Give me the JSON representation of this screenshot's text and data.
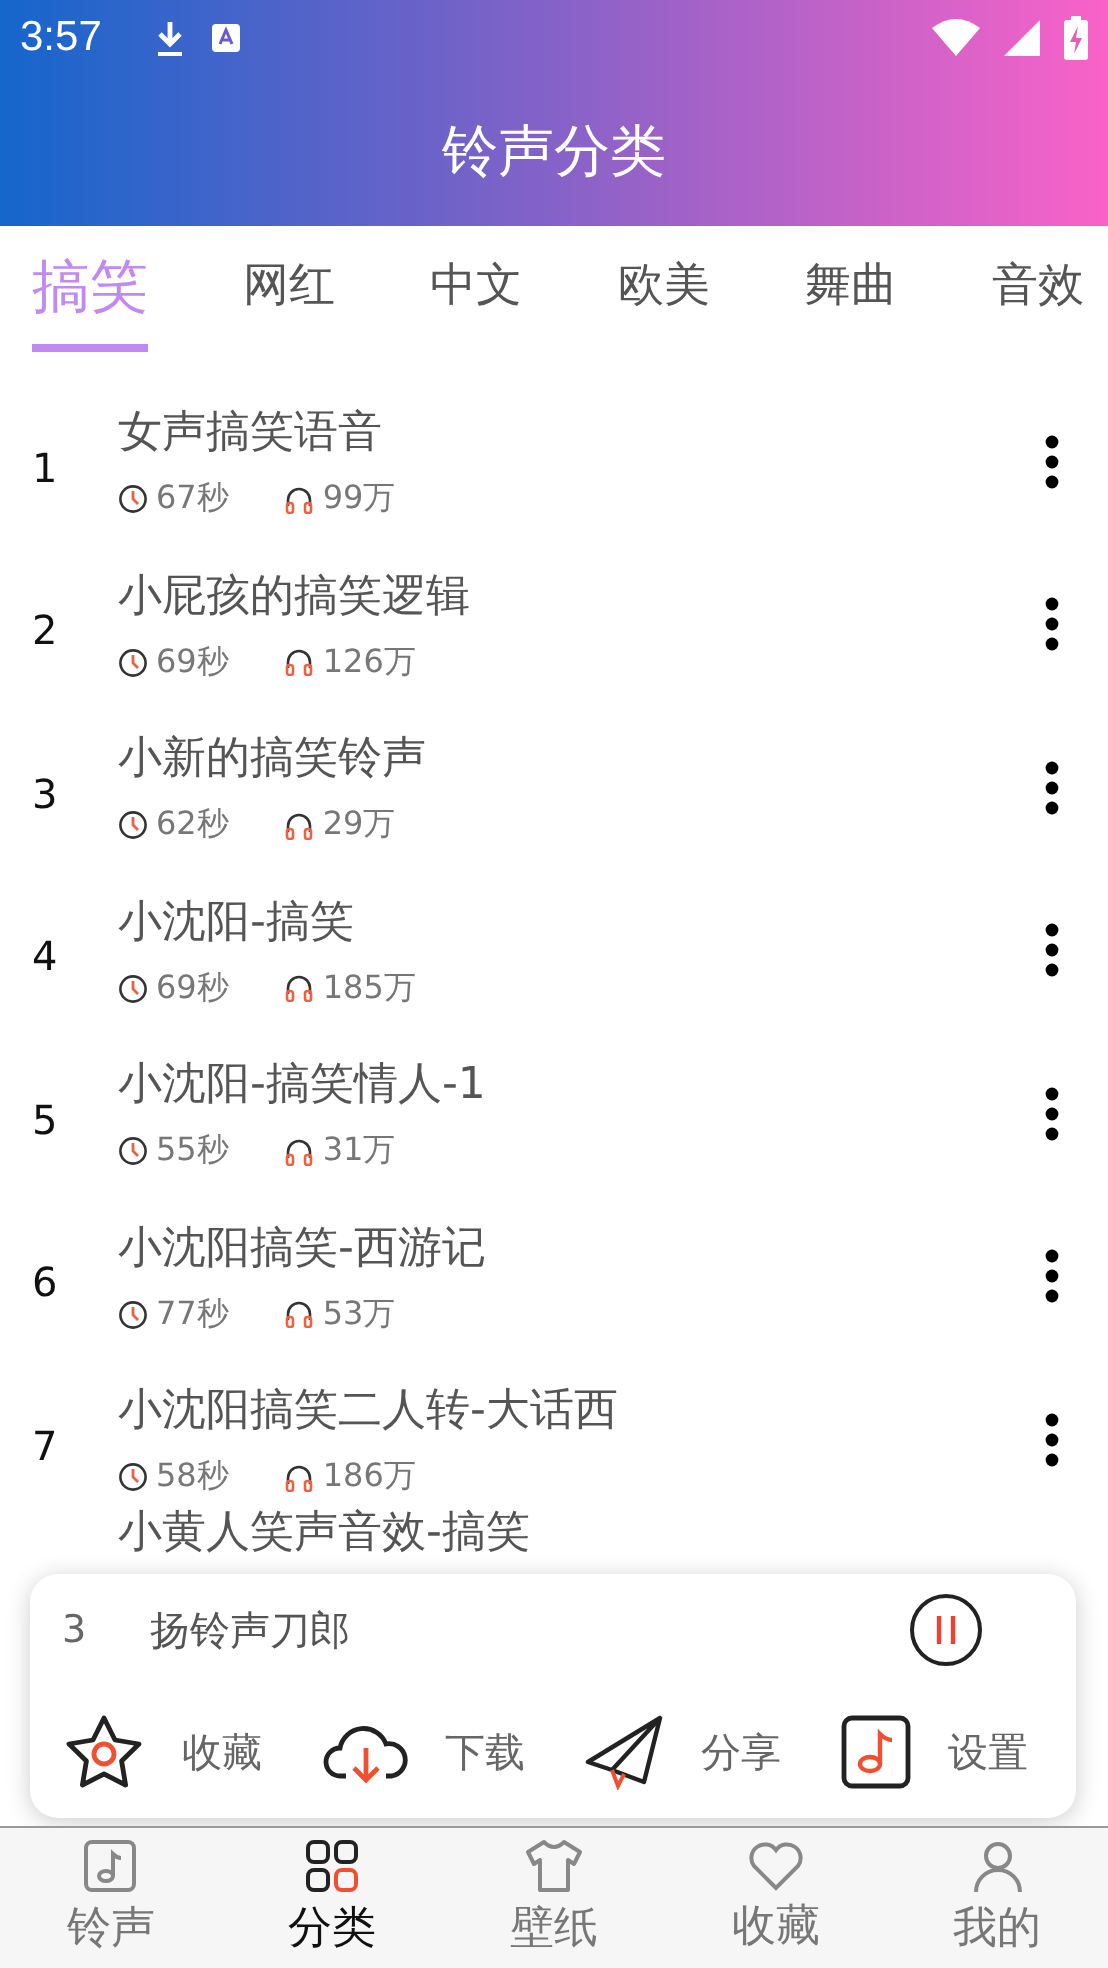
{
  "status_bar": {
    "time": "3:57"
  },
  "header": {
    "title": "铃声分类"
  },
  "tabs": [
    {
      "label": "搞笑",
      "selected": true
    },
    {
      "label": "网红",
      "selected": false
    },
    {
      "label": "中文",
      "selected": false
    },
    {
      "label": "欧美",
      "selected": false
    },
    {
      "label": "舞曲",
      "selected": false
    },
    {
      "label": "音效",
      "selected": false
    }
  ],
  "rows": [
    {
      "index": "1",
      "title": "女声搞笑语音",
      "duration": "67秒",
      "plays": "99万"
    },
    {
      "index": "2",
      "title": "小屁孩的搞笑逻辑",
      "duration": "69秒",
      "plays": "126万"
    },
    {
      "index": "3",
      "title": "小新的搞笑铃声",
      "duration": "62秒",
      "plays": "29万"
    },
    {
      "index": "4",
      "title": "小沈阳-搞笑",
      "duration": "69秒",
      "plays": "185万"
    },
    {
      "index": "5",
      "title": "小沈阳-搞笑情人-1",
      "duration": "55秒",
      "plays": "31万"
    },
    {
      "index": "6",
      "title": "小沈阳搞笑-西游记",
      "duration": "77秒",
      "plays": "53万"
    },
    {
      "index": "7",
      "title": "小沈阳搞笑二人转-大话西",
      "duration": "58秒",
      "plays": "186万"
    },
    {
      "title": "小黄人笑声音效-搞笑"
    }
  ],
  "player": {
    "index": "3",
    "title": "扬铃声刀郎",
    "playing": true,
    "actions": [
      {
        "kind": "star",
        "label": "收藏"
      },
      {
        "kind": "download",
        "label": "下载"
      },
      {
        "kind": "share",
        "label": "分享"
      },
      {
        "kind": "music",
        "label": "设置"
      }
    ]
  },
  "bottom_nav": [
    {
      "kind": "music",
      "label": "铃声",
      "selected": false
    },
    {
      "kind": "grid",
      "label": "分类",
      "selected": true
    },
    {
      "kind": "shirt",
      "label": "壁纸",
      "selected": false
    },
    {
      "kind": "heart",
      "label": "收藏",
      "selected": false
    },
    {
      "kind": "person",
      "label": "我的",
      "selected": false
    }
  ]
}
